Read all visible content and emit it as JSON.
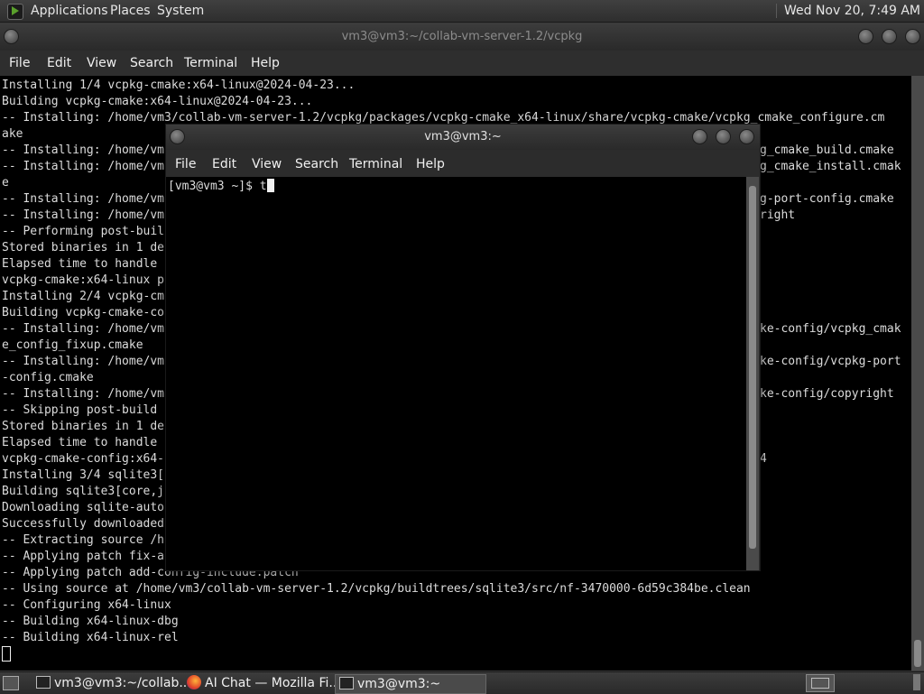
{
  "top_panel": {
    "menus": [
      "Applications",
      "Places",
      "System"
    ],
    "clock": "Wed Nov 20, 7:49 AM"
  },
  "main_window": {
    "title": "vm3@vm3:~/collab-vm-server-1.2/vcpkg",
    "menu": [
      "File",
      "Edit",
      "View",
      "Search",
      "Terminal",
      "Help"
    ],
    "lines": [
      "Installing 1/4 vcpkg-cmake:x64-linux@2024-04-23...",
      "Building vcpkg-cmake:x64-linux@2024-04-23...",
      "-- Installing: /home/vm3/collab-vm-server-1.2/vcpkg/packages/vcpkg-cmake_x64-linux/share/vcpkg-cmake/vcpkg_cmake_configure.cm",
      "ake",
      "-- Installing: /home/vm",
      "-- Installing: /home/vm",
      "e",
      "-- Installing: /home/vm",
      "-- Installing: /home/vm",
      "-- Performing post-buil",
      "Stored binaries in 1 de",
      "Elapsed time to handle",
      "vcpkg-cmake:x64-linux p",
      "Installing 2/4 vcpkg-cm",
      "Building vcpkg-cmake-co",
      "-- Installing: /home/vm",
      "e_config_fixup.cmake",
      "-- Installing: /home/vm",
      "-config.cmake",
      "-- Installing: /home/vm",
      "-- Skipping post-build",
      "Stored binaries in 1 de",
      "Elapsed time to handle",
      "vcpkg-cmake-config:x64-",
      "Installing 3/4 sqlite3[",
      "Building sqlite3[core,j",
      "Downloading sqlite-auto",
      "Successfully downloaded",
      "-- Extracting source /h",
      "-- Applying patch fix-a",
      "-- Applying patch add-config-include.patch",
      "-- Using source at /home/vm3/collab-vm-server-1.2/vcpkg/buildtrees/sqlite3/src/nf-3470000-6d59c384be.clean",
      "-- Configuring x64-linux",
      "-- Building x64-linux-dbg",
      "-- Building x64-linux-rel"
    ],
    "right_fragments": [
      {
        "row": 4,
        "text": "g_cmake_build.cmake"
      },
      {
        "row": 5,
        "text": "g_cmake_install.cmak"
      },
      {
        "row": 7,
        "text": "g-port-config.cmake"
      },
      {
        "row": 8,
        "text": "right"
      },
      {
        "row": 15,
        "text": "ke-config/vcpkg_cmak"
      },
      {
        "row": 17,
        "text": "ke-config/vcpkg-port"
      },
      {
        "row": 19,
        "text": "ke-config/copyright"
      },
      {
        "row": 23,
        "text": "4"
      }
    ]
  },
  "popup_window": {
    "title": "vm3@vm3:~",
    "menu": [
      "File",
      "Edit",
      "View",
      "Search",
      "Terminal",
      "Help"
    ],
    "prompt": "[vm3@vm3 ~]$ ",
    "typed": "t"
  },
  "taskbar": {
    "items": [
      {
        "label": "vm3@vm3:~/collab...",
        "icon": "terminal-icon",
        "active": false
      },
      {
        "label": "AI Chat — Mozilla Fi...",
        "icon": "firefox-icon",
        "active": false
      },
      {
        "label": "vm3@vm3:~",
        "icon": "terminal-icon",
        "active": true
      }
    ]
  }
}
